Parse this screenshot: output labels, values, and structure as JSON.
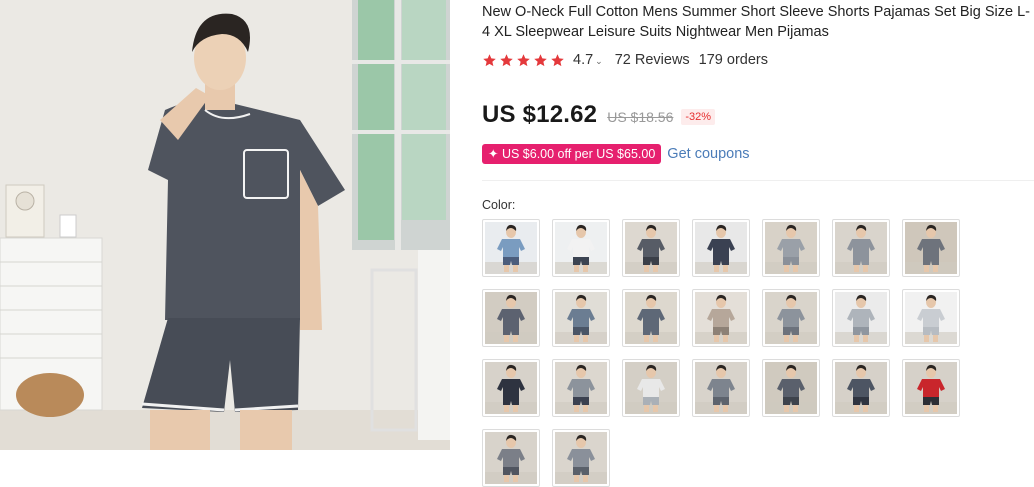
{
  "product": {
    "title": "New O-Neck Full Cotton Mens Summer Short Sleeve Shorts Pajamas Set Big Size L-4 XL Sleepwear Leisure Suits Nightwear Men Pijamas",
    "rating": "4.7",
    "rating_stars": 4.7,
    "reviews": "72 Reviews",
    "orders": "179 orders"
  },
  "price": {
    "current": "US $12.62",
    "original": "US $18.56",
    "discount": "-32%"
  },
  "coupon": {
    "label": "✦ US $6.00 off per US $65.00",
    "link": "Get coupons"
  },
  "color": {
    "label": "Color:",
    "swatches": [
      {
        "shirt": "#7a9cc0",
        "pants": "#4b5d7c",
        "bg": "#e9ecef"
      },
      {
        "shirt": "#f2f2f2",
        "pants": "#3c4452",
        "bg": "#eef0f1"
      },
      {
        "shirt": "#575c66",
        "pants": "#3b3f48",
        "bg": "#ddd8d0"
      },
      {
        "shirt": "#3a4152",
        "pants": "#3a4152",
        "bg": "#e8e8e8"
      },
      {
        "shirt": "#9aa0a8",
        "pants": "#8a9099",
        "bg": "#d8d2c8"
      },
      {
        "shirt": "#8d939c",
        "pants": "#8d939c",
        "bg": "#d9d4cc"
      },
      {
        "shirt": "#6e737c",
        "pants": "#6e737c",
        "bg": "#cfc7bb"
      },
      {
        "shirt": "#5c6270",
        "pants": "#5c6270",
        "bg": "#d2ccc2"
      },
      {
        "shirt": "#6b7d92",
        "pants": "#4a5566",
        "bg": "#e0ddd6"
      },
      {
        "shirt": "#5e6877",
        "pants": "#5e6877",
        "bg": "#ddd8ce"
      },
      {
        "shirt": "#b6a79a",
        "pants": "#8d8176",
        "bg": "#e4dfd8"
      },
      {
        "shirt": "#8c939c",
        "pants": "#6c727c",
        "bg": "#d9d4cb"
      },
      {
        "shirt": "#aeb4bb",
        "pants": "#8f969f",
        "bg": "#ebebeb"
      },
      {
        "shirt": "#c9cdd2",
        "pants": "#b7bcc2",
        "bg": "#f1f1f1"
      },
      {
        "shirt": "#2e3340",
        "pants": "#2e3340",
        "bg": "#d7d2ca"
      },
      {
        "shirt": "#8c939c",
        "pants": "#3b4150",
        "bg": "#dcd7cf"
      },
      {
        "shirt": "#e8e8e8",
        "pants": "#aab0b7",
        "bg": "#d4cfc6"
      },
      {
        "shirt": "#7d848e",
        "pants": "#5d636d",
        "bg": "#d8d3cb"
      },
      {
        "shirt": "#5a606c",
        "pants": "#3e434c",
        "bg": "#d0cabf"
      },
      {
        "shirt": "#4d5563",
        "pants": "#2f3440",
        "bg": "#d6d1c9"
      },
      {
        "shirt": "#c9262c",
        "pants": "#2d2f36",
        "bg": "#d6d1c9"
      },
      {
        "shirt": "#7b7f88",
        "pants": "#505560",
        "bg": "#d8d3cb"
      },
      {
        "shirt": "#8a909a",
        "pants": "#5a606a",
        "bg": "#dad5cd"
      }
    ]
  },
  "colors": {
    "star": "#e4393c",
    "price": "#191919",
    "coupon_bg": "#e6206e",
    "link": "#4b7cb8",
    "discount": "#e62e2e"
  }
}
